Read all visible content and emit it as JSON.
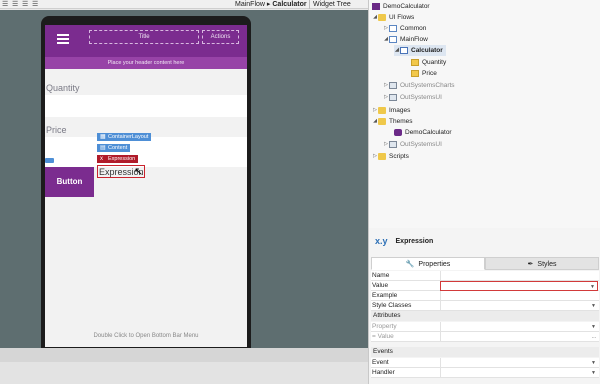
{
  "breadcrumb": {
    "parent": "MainFlow",
    "sep": "▸",
    "current": "Calculator"
  },
  "widget_tree_label": "Widget Tree",
  "app": {
    "header_title": "Title",
    "header_actions": "Actions",
    "header_placeholder": "Place your header content here",
    "quantity_label": "Quantity",
    "price_label": "Price",
    "chips": {
      "container": "ContainerLayout",
      "content": "Content",
      "expression": "Expression"
    },
    "button_label": "Button",
    "expression_text": "Expression",
    "bottom_hint": "Double Click to Open Bottom Bar Menu"
  },
  "tree": {
    "root": "DemoCalculator",
    "ui_flows": "UI Flows",
    "common": "Common",
    "mainflow": "MainFlow",
    "calculator": "Calculator",
    "quantity": "Quantity",
    "price": "Price",
    "charts": "OutSystemsCharts",
    "osui": "OutSystemsUI",
    "images": "Images",
    "themes": "Themes",
    "theme_demo": "DemoCalculator",
    "theme_osui": "OutSystemsUI",
    "scripts": "Scripts"
  },
  "properties": {
    "type_icon": "x.y",
    "title": "Expression",
    "tab_properties": "Properties",
    "tab_styles": "Styles",
    "rows": {
      "name": "Name",
      "value": "Value",
      "example": "Example",
      "style_classes": "Style Classes",
      "attributes": "Attributes",
      "property": "Property",
      "attr_value": "= Value",
      "events": "Events",
      "event": "Event",
      "handler": "Handler"
    },
    "ellipsis": "...",
    "dropdown_glyph": "▼"
  }
}
